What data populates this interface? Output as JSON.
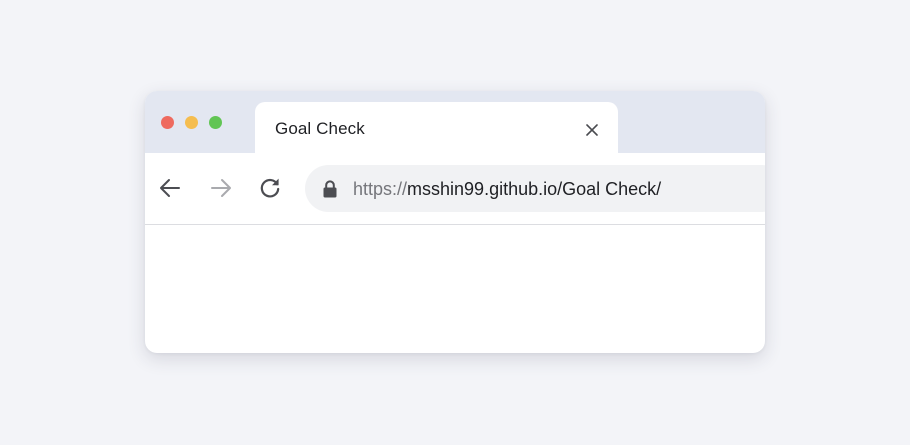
{
  "window": {
    "controls": {
      "close_color": "#ee6a5f",
      "minimize_color": "#f5bd4f",
      "zoom_color": "#61c554"
    }
  },
  "tab": {
    "title": "Goal Check",
    "close_icon": "close-icon"
  },
  "toolbar": {
    "back_icon": "arrow-left-icon",
    "forward_icon": "arrow-right-icon",
    "forward_enabled": false,
    "reload_icon": "reload-icon"
  },
  "address_bar": {
    "lock_icon": "lock-icon",
    "scheme": "https://",
    "url": "msshin99.github.io/Goal Check/"
  },
  "colors": {
    "background": "#f3f4f8",
    "titlebar": "#e3e7f1",
    "omnibox": "#f1f2f4"
  }
}
